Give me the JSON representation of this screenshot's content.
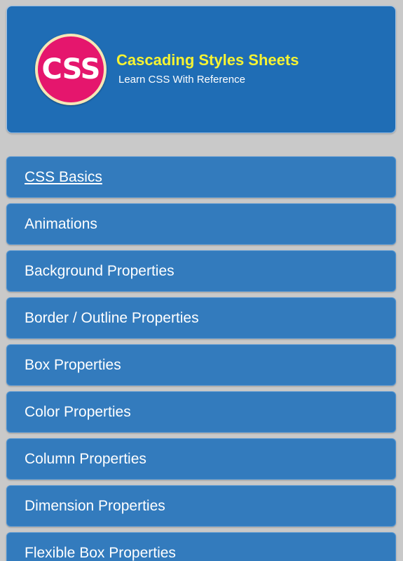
{
  "header": {
    "logo_text": "CSS",
    "title": "Cascading Styles Sheets",
    "subtitle": "Learn CSS With Reference"
  },
  "colors": {
    "background": "#c9c9c9",
    "header_bg": "#1f6db5",
    "menu_item_bg": "#337bbd",
    "title_color": "#f6f332",
    "logo_bg": "#e5166d"
  },
  "menu": {
    "items": [
      {
        "label": "CSS Basics"
      },
      {
        "label": "Animations"
      },
      {
        "label": "Background Properties"
      },
      {
        "label": "Border / Outline Properties"
      },
      {
        "label": "Box Properties"
      },
      {
        "label": "Color Properties"
      },
      {
        "label": "Column Properties"
      },
      {
        "label": "Dimension Properties"
      },
      {
        "label": "Flexible Box Properties"
      }
    ]
  }
}
